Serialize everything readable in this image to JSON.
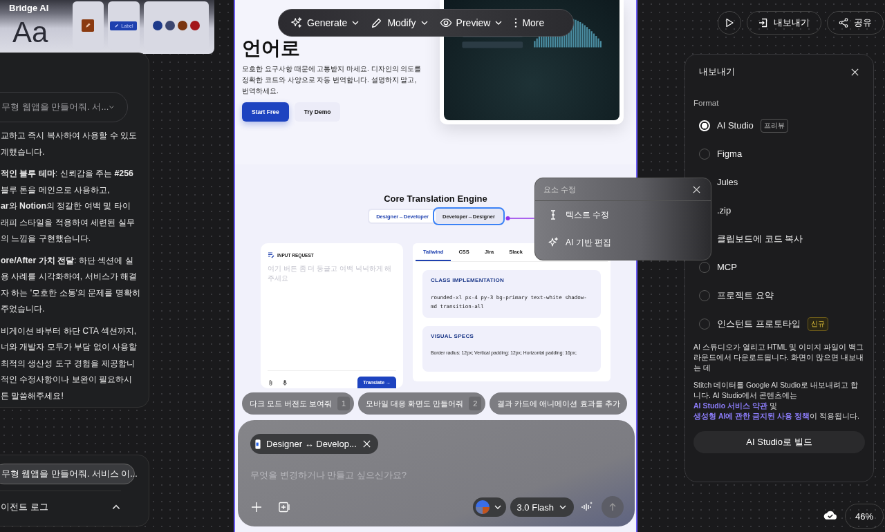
{
  "design_system_card": {
    "title": "Bridge AI",
    "type_sample": "Aa",
    "sample_button": "Label"
  },
  "chat": {
    "prompt_dropdown": "무형 웹앱을 만들어줘. 서...",
    "paragraphs": [
      {
        "lines": [
          "교하고 즉시 복사하여 사용할 수 있도",
          "계했습니다."
        ]
      },
      {
        "lines": [
          "**적인 블루 테마**: 신뢰감을 주는 **#256**",
          "블루 톤을 메인으로 사용하고,",
          "**ar**와 **Notion**의 정갈한 여백 및 타이",
          "래피 스타일을 적용하여 세련된 실무",
          "의 느낌을 구현했습니다."
        ]
      },
      {
        "lines": [
          "**ore/After 가치 전달**: 하단 섹션에 실",
          "용 사례를 시각화하여, 서비스가 해결",
          "자 하는 '모호한 소통'의 문제를 명확히",
          "주었습니다."
        ]
      },
      {
        "lines": [
          "비게이션 바부터 하단 CTA 섹션까지,",
          "너와 개발자 모두가 부담 없이 사용할",
          "최적의 생산성 도구 경험을 제공합니",
          "적인 수정사항이나 보완이 필요하시",
          "든 말씀해주세요!"
        ]
      }
    ],
    "prompt_pill": "무형 웹앱을 만들어줘. 서비스 이...",
    "agent_log": {
      "label": "이전트 로그",
      "expanded": true
    }
  },
  "toolbar": [
    {
      "label": "Generate",
      "menu": true
    },
    {
      "label": "Modify",
      "menu": true
    },
    {
      "label": "Preview",
      "menu": true
    },
    {
      "label": "More",
      "menu": false
    }
  ],
  "artboard": {
    "headline": "언어로",
    "intro": "모호한 요구사항 때문에 고통받지 마세요. 디자인의 의도를 정확한 코드와 사양으로 자동 번역합니다. 설명하지 말고, 번역하세요.",
    "buttons": [
      {
        "label": "Start Free",
        "primary": true
      },
      {
        "label": "Try Demo",
        "primary": false
      }
    ],
    "section_title": "Core Translation Engine",
    "modes": [
      {
        "from": "Designer",
        "arrow": "→",
        "to": "Developer",
        "selected": true,
        "editor_selected": false
      },
      {
        "from": "Developer",
        "arrow": "→",
        "to": "Designer",
        "selected": false,
        "editor_selected": true
      }
    ],
    "input_card": {
      "title": "INPUT REQUEST",
      "placeholder": "여기 버튼 좀 더 둥글고 여백 넉넉하게 해주세요",
      "button": "Translate →"
    },
    "output_tabs": [
      {
        "label": "Tailwind",
        "selected": true
      },
      {
        "label": "CSS",
        "selected": false
      },
      {
        "label": "Jira",
        "selected": false
      },
      {
        "label": "Slack",
        "selected": false
      }
    ],
    "output_blocks": [
      {
        "title": "CLASS IMPLEMENTATION",
        "body": "rounded-xl px-4 py-3 bg-primary text-white shadow-md transition-all",
        "kind": "code"
      },
      {
        "title": "VISUAL SPECS",
        "body": "Border radius: 12px; Vertical padding: 12px; Horizontal padding: 16px;",
        "kind": "text"
      }
    ]
  },
  "element_menu": {
    "title": "요소 수정",
    "items": [
      {
        "label": "텍스트 수정"
      },
      {
        "label": "AI 기반 편집"
      }
    ]
  },
  "suggestions": [
    {
      "text": "다크 모드 버전도 보여줘",
      "shortcut": "1"
    },
    {
      "text": "모바일 대응 화면도 만들어줘",
      "shortcut": "2"
    },
    {
      "text": "결과 카드에 애니메이션 효과를 추가"
    }
  ],
  "composer": {
    "attachment": "Designer ↔ Develop...",
    "placeholder": "무엇을 변경하거나 만들고 싶으신가요?",
    "model": "3.0 Flash"
  },
  "top_actions": {
    "export": "내보내기",
    "share": "공유"
  },
  "export_panel": {
    "title": "내보내기",
    "format_label": "Format",
    "options": [
      {
        "label": "AI Studio",
        "selected": true,
        "badge": {
          "text": "프리뷰",
          "kind": "preview"
        }
      },
      {
        "label": "Figma",
        "selected": false
      },
      {
        "label": "Jules"
      },
      {
        "label": ".zip"
      },
      {
        "label": "클립보드에 코드 복사"
      },
      {
        "label": "MCP",
        "selected": false
      },
      {
        "label": "프로젝트 요약",
        "selected": false
      },
      {
        "label": "인스턴트 프로토타입",
        "selected": false,
        "badge": {
          "text": "신규",
          "kind": "new"
        }
      }
    ],
    "description": "AI 스튜디오가 열리고 HTML 및 이미지 파일이 백그라운드에서 다운로드됩니다. 화면이 많으면 내보내는 데",
    "notice": [
      {
        "text": "Stitch 데이터를 Google AI Studio로 내보내려고 합니다. AI Studio에서 콘텐츠에는 ",
        "kind": "text"
      },
      {
        "text": "AI Studio 서비스 약관",
        "kind": "link"
      },
      {
        "text": " 및 ",
        "kind": "text"
      },
      {
        "text": "생성형 AI에 관한 금지된 사용 정책",
        "kind": "link"
      },
      {
        "text": "이 적용됩니다.",
        "kind": "text"
      }
    ],
    "build_button": "AI Studio로 빌드"
  },
  "zoom": "46%"
}
